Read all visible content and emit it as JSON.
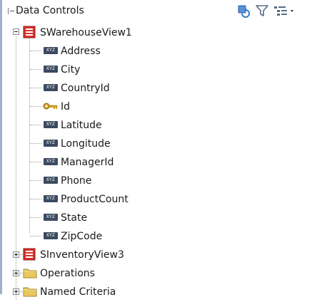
{
  "panel": {
    "title": "Data Controls",
    "toolbar": {
      "refresh_icon": "refresh-icon",
      "filter_icon": "filter-icon",
      "options_icon": "tree-options-icon"
    }
  },
  "tree": {
    "root": {
      "label": "SWarehouseView1",
      "expanded": true,
      "children": [
        {
          "label": "Address",
          "icon": "attribute-icon",
          "badge": "XYZ"
        },
        {
          "label": "City",
          "icon": "attribute-icon",
          "badge": "XYZ"
        },
        {
          "label": "CountryId",
          "icon": "attribute-icon",
          "badge": "XYZ"
        },
        {
          "label": "Id",
          "icon": "key-icon"
        },
        {
          "label": "Latitude",
          "icon": "attribute-icon",
          "badge": "XYZ"
        },
        {
          "label": "Longitude",
          "icon": "attribute-icon",
          "badge": "XYZ"
        },
        {
          "label": "ManagerId",
          "icon": "attribute-icon",
          "badge": "XYZ"
        },
        {
          "label": "Phone",
          "icon": "attribute-icon",
          "badge": "XYZ"
        },
        {
          "label": "ProductCount",
          "icon": "attribute-icon",
          "badge": "XYZ"
        },
        {
          "label": "State",
          "icon": "attribute-icon",
          "badge": "XYZ"
        },
        {
          "label": "ZipCode",
          "icon": "attribute-icon",
          "badge": "XYZ"
        }
      ]
    },
    "siblings": [
      {
        "label": "SInventoryView3",
        "icon": "view-object-icon",
        "expanded": false
      },
      {
        "label": "Operations",
        "icon": "folder-icon",
        "expanded": false
      },
      {
        "label": "Named Criteria",
        "icon": "folder-icon",
        "expanded": false
      }
    ]
  },
  "colors": {
    "accent": "#9db2cc",
    "view_icon_red": "#d9312b",
    "folder_yellow": "#e8c860",
    "attribute_badge": "#3b4a60",
    "key_gold": "#d9a520"
  }
}
